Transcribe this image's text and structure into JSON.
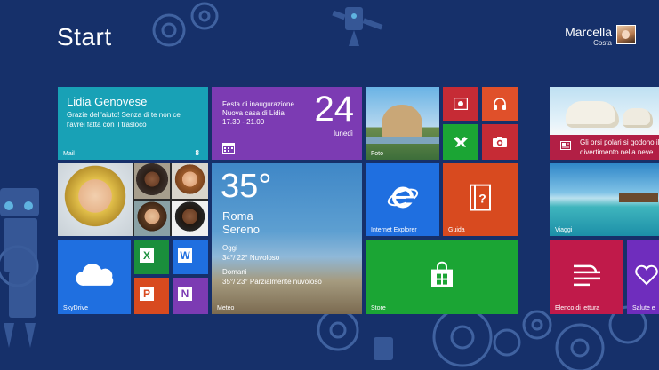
{
  "header": {
    "title": "Start"
  },
  "user": {
    "first_name": "Marcella",
    "last_name": "Costa"
  },
  "tiles": {
    "mail": {
      "sender": "Lidia Genovese",
      "message": "Grazie dell'aiuto! Senza di te non ce l'avrei fatta con il trasloco",
      "label": "Mail",
      "count": "8"
    },
    "calendar": {
      "event": "Festa di inaugurazione",
      "location": "Nuova casa di Lidia",
      "time": "17.30 - 21.00",
      "day": "24",
      "weekday": "lunedì"
    },
    "weather": {
      "temp": "35°",
      "city": "Roma",
      "condition": "Sereno",
      "today_label": "Oggi",
      "today_forecast": "34°/ 22° Nuvoloso",
      "tomorrow_label": "Domani",
      "tomorrow_forecast": "35°/ 23° Parzialmente nuvoloso",
      "label": "Meteo"
    },
    "photos": {
      "label": "Foto"
    },
    "ie": {
      "label": "Internet Explorer"
    },
    "guide": {
      "label": "Guida"
    },
    "store": {
      "label": "Store"
    },
    "skydrive": {
      "label": "SkyDrive"
    },
    "news": {
      "headline": "Gli orsi polari si godono il divertimento nella neve"
    },
    "travel": {
      "label": "Viaggi"
    },
    "reading": {
      "label": "Elenco di lettura"
    },
    "health": {
      "label": "Salute e"
    }
  },
  "colors": {
    "background": "#16306a",
    "mail": "#18a1b6",
    "calendar": "#7c3bb3",
    "ie": "#1f6fe0",
    "guide": "#d84a1f",
    "store": "#1ba534",
    "skydrive": "#1f6fe0",
    "excel": "#1a8f3c",
    "word": "#1f6fe0",
    "powerpoint": "#d84a1f",
    "onenote": "#7c3bb3",
    "red": "#c62b35",
    "music": "#e0502a",
    "xbox": "#1ba534",
    "camera": "#c62b35",
    "reading": "#c01a4a",
    "health": "#6f2dbd"
  }
}
